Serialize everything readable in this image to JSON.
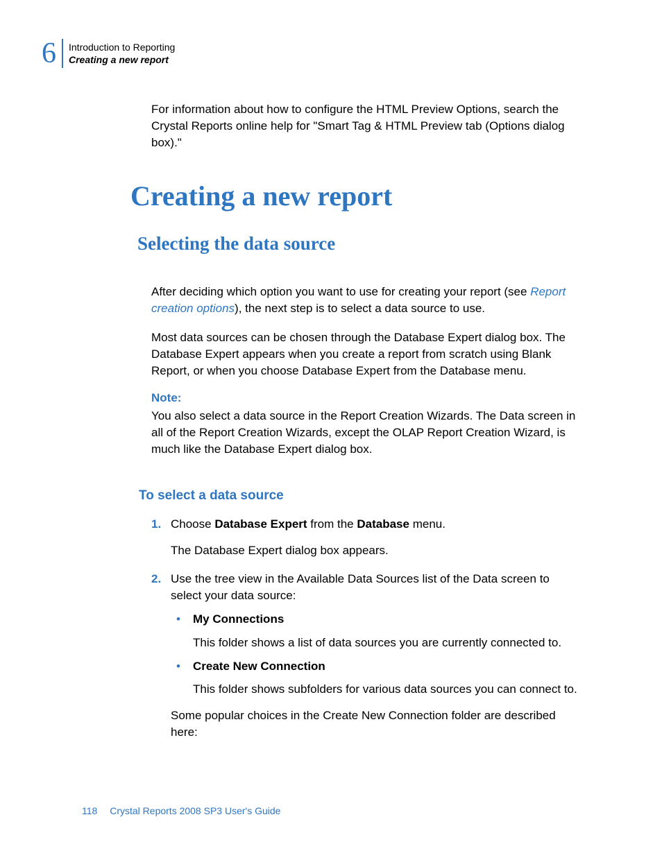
{
  "header": {
    "chapter_number": "6",
    "line1": "Introduction to Reporting",
    "line2": "Creating a new report"
  },
  "intro_paragraph": "For information about how to configure the HTML Preview Options, search the Crystal Reports online help for \"Smart Tag & HTML Preview tab (Options dialog box).\"",
  "h1": "Creating a new report",
  "h2": "Selecting the data source",
  "para1_a": "After deciding which option you want to use for creating your report (see ",
  "para1_link": "Report creation options",
  "para1_b": "), the next step is to select a data source to use.",
  "para2": "Most data sources can be chosen through the Database Expert dialog box. The Database Expert appears when you create a report from scratch using Blank Report, or when you choose Database Expert from the Database menu.",
  "note_label": "Note:",
  "note_body": "You also select a data source in the Report Creation Wizards. The Data screen in all of the Report Creation Wizards, except the OLAP Report Creation Wizard, is much like the Database Expert dialog box.",
  "h3": "To select a data source",
  "steps": [
    {
      "num": "1.",
      "text_a": "Choose ",
      "bold1": "Database Expert",
      "text_b": " from the ",
      "bold2": "Database",
      "text_c": " menu.",
      "sub": "The Database Expert dialog box appears."
    },
    {
      "num": "2.",
      "text": "Use the tree view in the Available Data Sources list of the Data screen to select your data source:",
      "bullets": [
        {
          "title": "My Connections",
          "desc": "This folder shows a list of data sources you are currently connected to."
        },
        {
          "title": "Create New Connection",
          "desc": "This folder shows subfolders for various data sources you can connect to."
        }
      ],
      "tail": "Some popular choices in the Create New Connection folder are described here:"
    }
  ],
  "footer": {
    "page": "118",
    "title": "Crystal Reports 2008 SP3 User's Guide"
  }
}
